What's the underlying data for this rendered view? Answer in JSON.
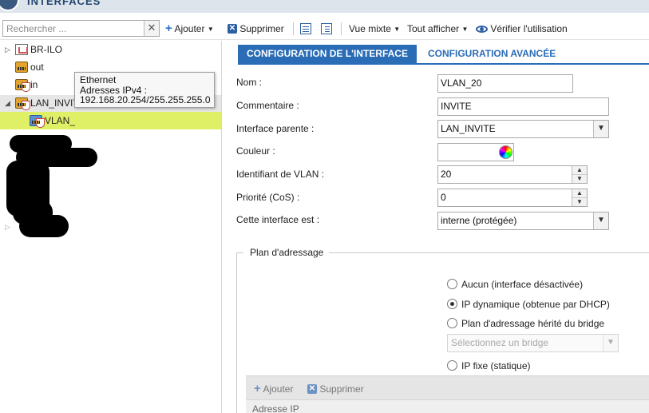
{
  "app": {
    "title": "INTERFACES"
  },
  "toolbar": {
    "search_placeholder": "Rechercher ...",
    "clear_label": "✕",
    "add_label": "Ajouter",
    "delete_label": "Supprimer",
    "mixed_view_label": "Vue mixte",
    "show_all_label": "Tout afficher",
    "check_usage_label": "Vérifier l'utilisation"
  },
  "tree": {
    "items": [
      {
        "label": "BR-ILO"
      },
      {
        "label": "out"
      },
      {
        "label": "in"
      },
      {
        "label": "LAN_INVITE"
      },
      {
        "label": "VLAN_"
      }
    ],
    "tooltip": {
      "line1": "Ethernet",
      "line2": "Adresses IPv4 :",
      "line3": "192.168.20.254/255.255.255.0"
    }
  },
  "tabs": [
    {
      "label": "CONFIGURATION DE L'INTERFACE",
      "active": true
    },
    {
      "label": "CONFIGURATION AVANCÉE",
      "active": false
    }
  ],
  "form": {
    "name_label": "Nom :",
    "name_value": "VLAN_20",
    "comment_label": "Commentaire :",
    "comment_value": "INVITE",
    "parent_label": "Interface parente :",
    "parent_value": "LAN_INVITE",
    "color_label": "Couleur :",
    "vlan_id_label": "Identifiant de VLAN :",
    "vlan_id_value": "20",
    "priority_label": "Priorité (CoS) :",
    "priority_value": "0",
    "interface_type_label": "Cette interface est :",
    "interface_type_value": "interne (protégée)"
  },
  "addressing": {
    "legend": "Plan d'adressage",
    "options": [
      {
        "label": "Aucun (interface désactivée)",
        "selected": false
      },
      {
        "label": "IP dynamique (obtenue par DHCP)",
        "selected": true
      },
      {
        "label": "Plan d'adressage hérité du bridge",
        "selected": false
      },
      {
        "label": "IP fixe (statique)",
        "selected": false
      }
    ],
    "bridge_placeholder": "Sélectionnez un bridge",
    "add_label": "Ajouter",
    "delete_label": "Supprimer",
    "column_ip": "Adresse IP"
  },
  "colors": {
    "accent": "#2a6cb6",
    "highlight": "#dff066",
    "selected_row": "#e6e6e6"
  }
}
